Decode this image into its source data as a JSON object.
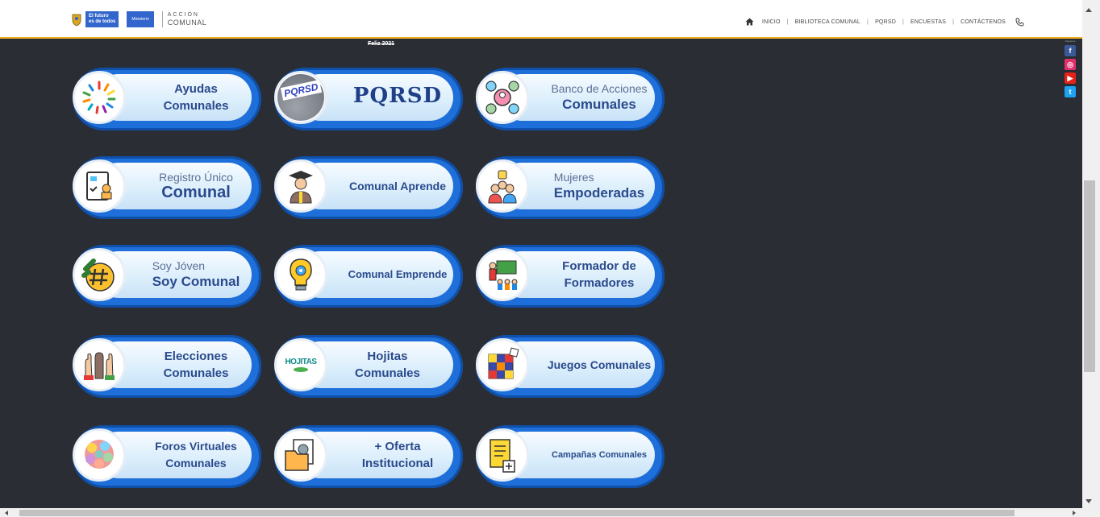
{
  "header": {
    "gov_line1": "El futuro",
    "gov_line2": "es de todos",
    "ministerio": "Ministerio",
    "accion_line1": "ACCIÓN",
    "accion_line2": "COMUNAL",
    "nav": [
      "INICIO",
      "BIBLIOTECA COMUNAL",
      "PQRSD",
      "ENCUESTAS",
      "CONTÁCTENOS"
    ]
  },
  "banner_text": "Feliz 2021",
  "cards": {
    "ayudas": {
      "a": "Ayudas",
      "b": "Comunales"
    },
    "pqrsd": {
      "main": "PQRSD",
      "sticker": "PQRSD"
    },
    "banco": {
      "thin": "Banco de Acciones",
      "thick": "Comunales"
    },
    "registro": {
      "thin": "Registro Único",
      "thick": "Comunal"
    },
    "aprende": {
      "label": "Comunal Aprende"
    },
    "mujeres": {
      "thin": "Mujeres",
      "thick": "Empoderadas"
    },
    "soyjoven": {
      "thin": "Soy Jóven",
      "thick": "Soy Comunal"
    },
    "emprende": {
      "label": "Comunal Emprende"
    },
    "formador": {
      "a": "Formador de",
      "b": "Formadores"
    },
    "elecciones": {
      "a": "Elecciones",
      "b": "Comunales"
    },
    "hojitas": {
      "a": "Hojitas",
      "b": "Comunales",
      "logo": "HOJITAS"
    },
    "juegos": {
      "label": "Juegos Comunales"
    },
    "foros": {
      "a": "Foros Virtuales",
      "b": "Comunales"
    },
    "oferta": {
      "a": "+ Oferta",
      "b": "Institucional"
    },
    "campanas": {
      "label": "Campañas Comunales"
    }
  },
  "social": {
    "hint": "Síguenos",
    "facebook": "f",
    "instagram": "◎",
    "youtube": "▶",
    "twitter": "t"
  },
  "colors": {
    "background": "#2a2d33",
    "ring": "#1e6fd9",
    "label": "#2a4a8c",
    "accent_line": "#f0b020"
  }
}
